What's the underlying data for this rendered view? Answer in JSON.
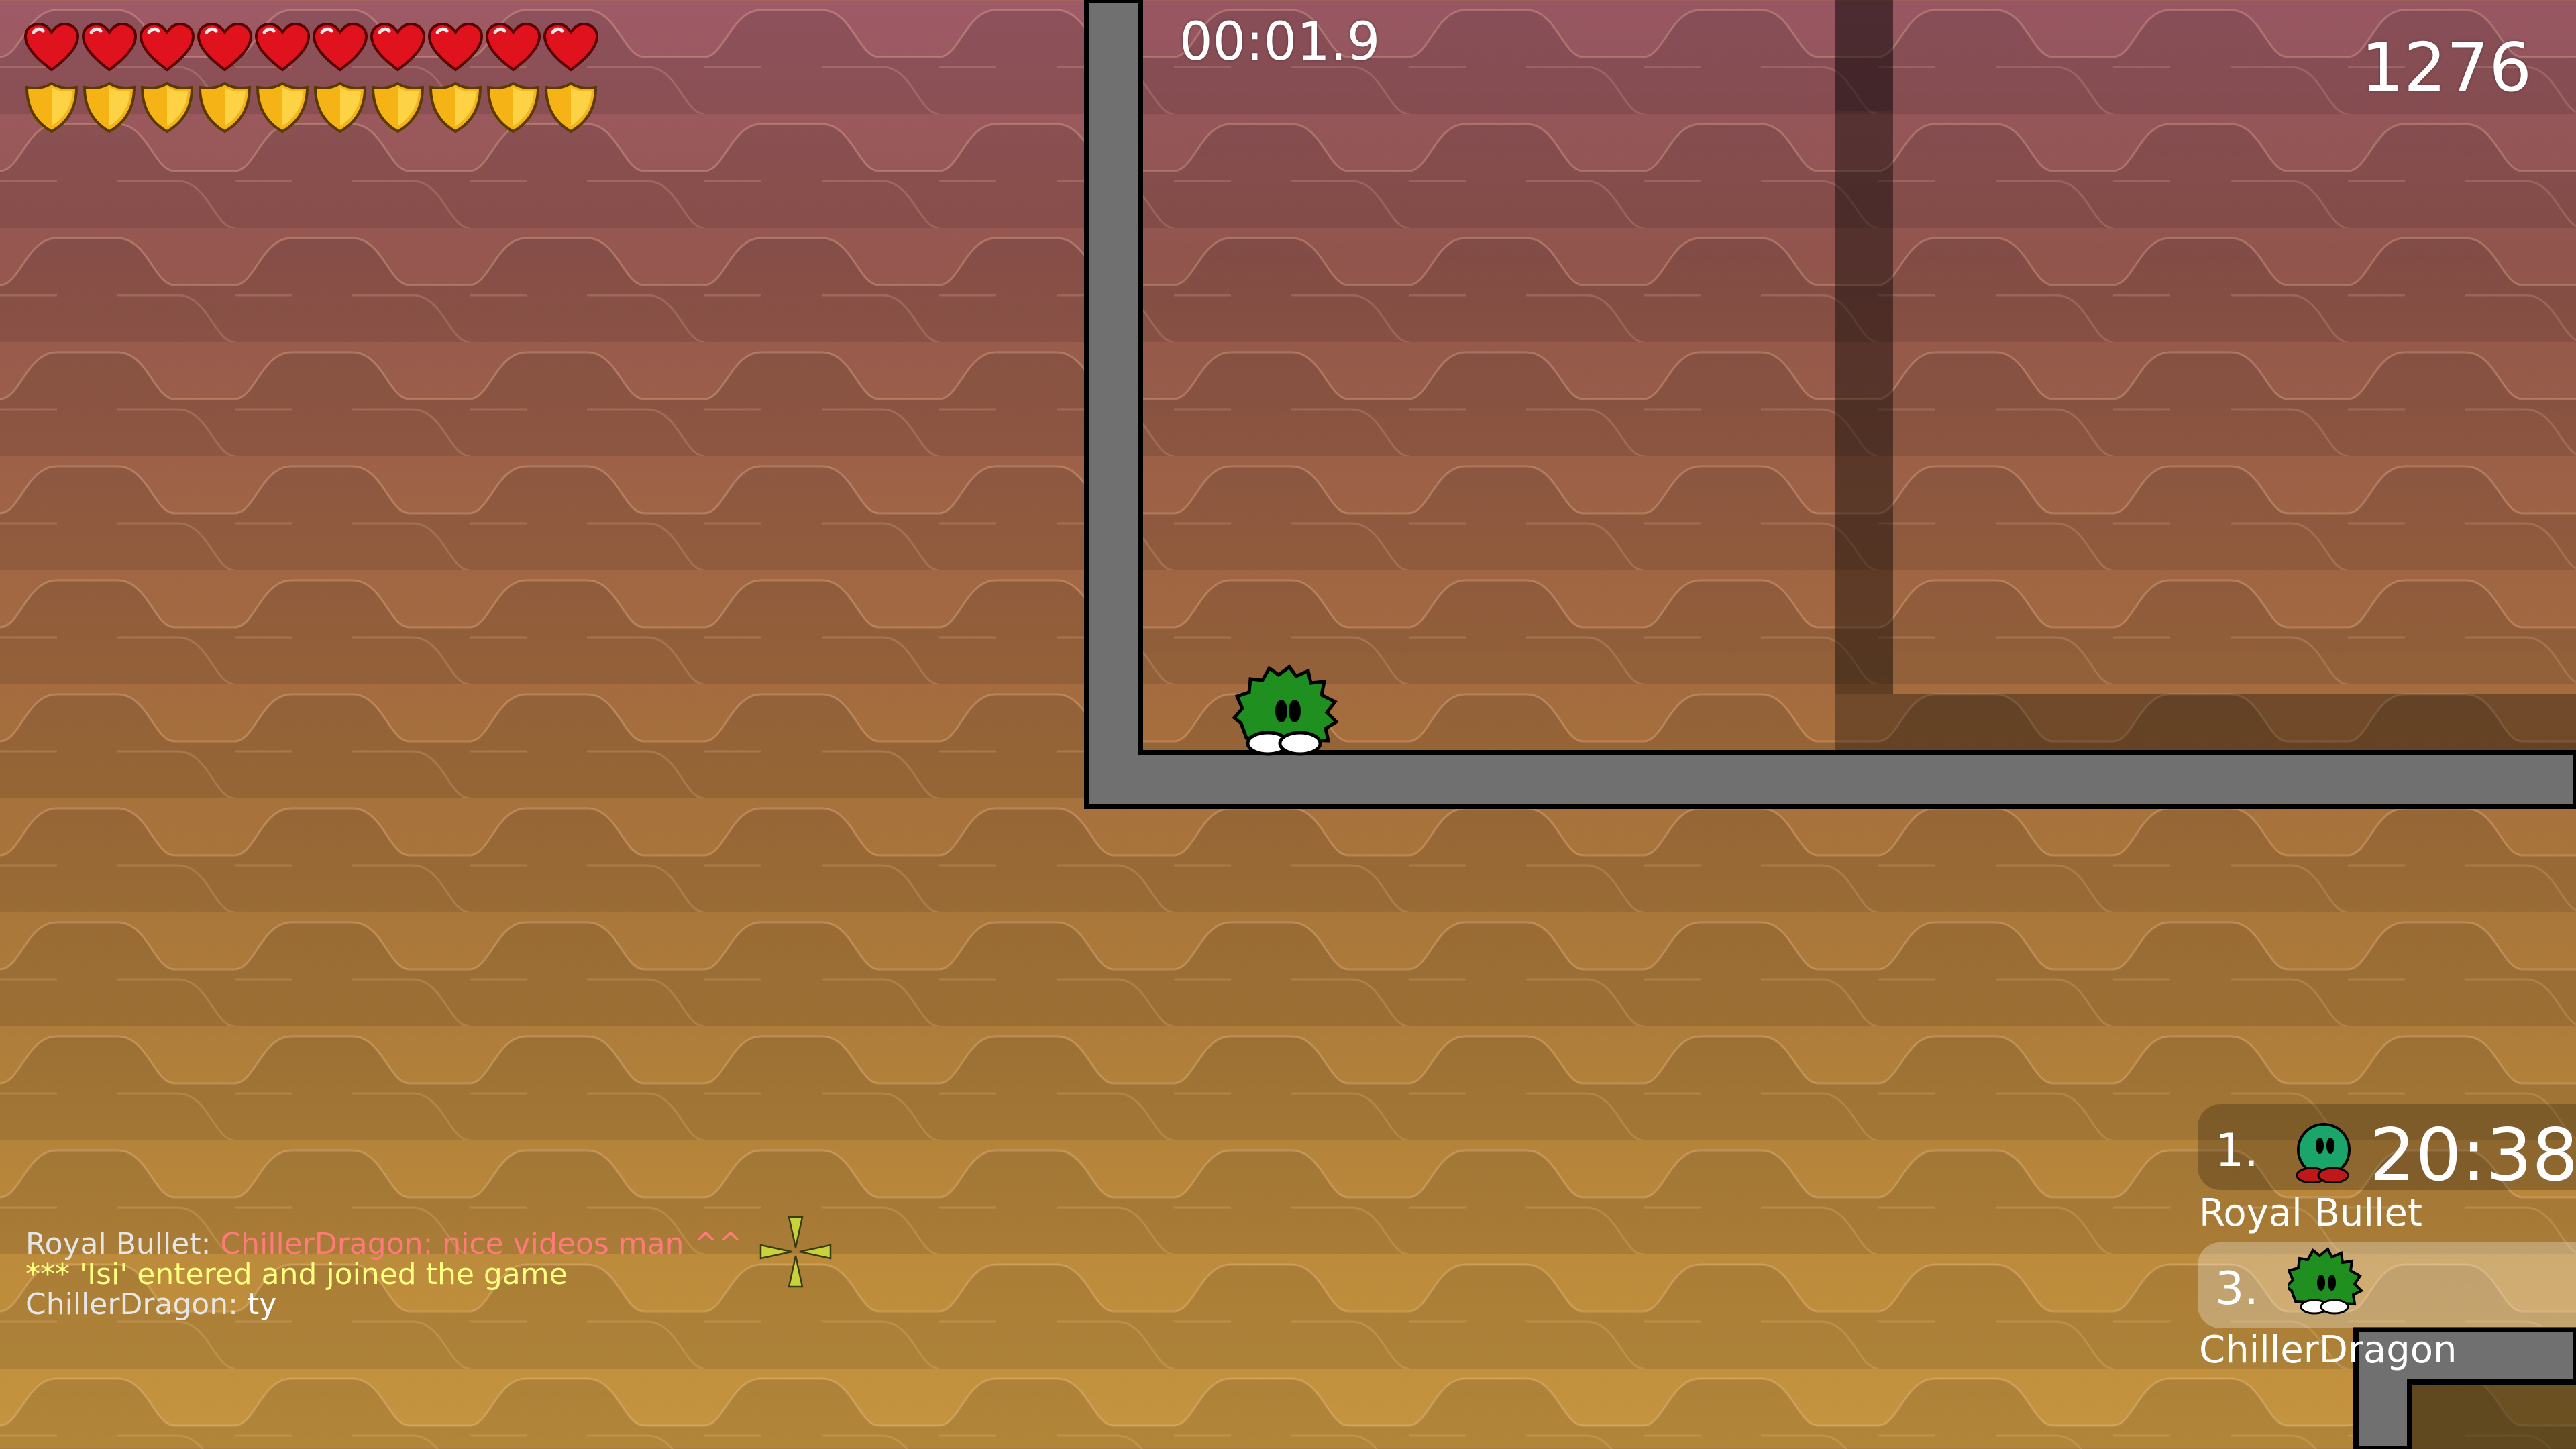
{
  "hud": {
    "health": {
      "current": 10,
      "max": 10,
      "icon": "heart-icon",
      "color": "#e0121e"
    },
    "armor": {
      "current": 10,
      "max": 10,
      "icon": "shield-icon",
      "color": "#f5b316"
    },
    "race_timer": "00:01.9",
    "score": "1276"
  },
  "chat": {
    "lines": [
      {
        "name": "Royal Bullet",
        "sep": ": ",
        "text": "ChillerDragon: nice videos man ^^",
        "highlight": true
      },
      {
        "system": "*** 'Isi' entered and joined the game"
      },
      {
        "name": "ChillerDragon",
        "sep": ": ",
        "text": "ty",
        "highlight": false
      }
    ]
  },
  "ranking": [
    {
      "rank": "1.",
      "time": "20:38",
      "name": "Royal Bullet",
      "skin_color": "#1aa56a"
    },
    {
      "rank": "3.",
      "time": "",
      "name": "ChillerDragon",
      "skin_color": "#1f8f1f",
      "is_self": true
    }
  ],
  "player": {
    "skin": "green-spiky-tee",
    "color": "#1f8f1f"
  },
  "colors": {
    "wall_fill": "#707070",
    "wall_outline": "#000000",
    "background_top": "#9e5a67",
    "background_bottom": "#c59540"
  }
}
